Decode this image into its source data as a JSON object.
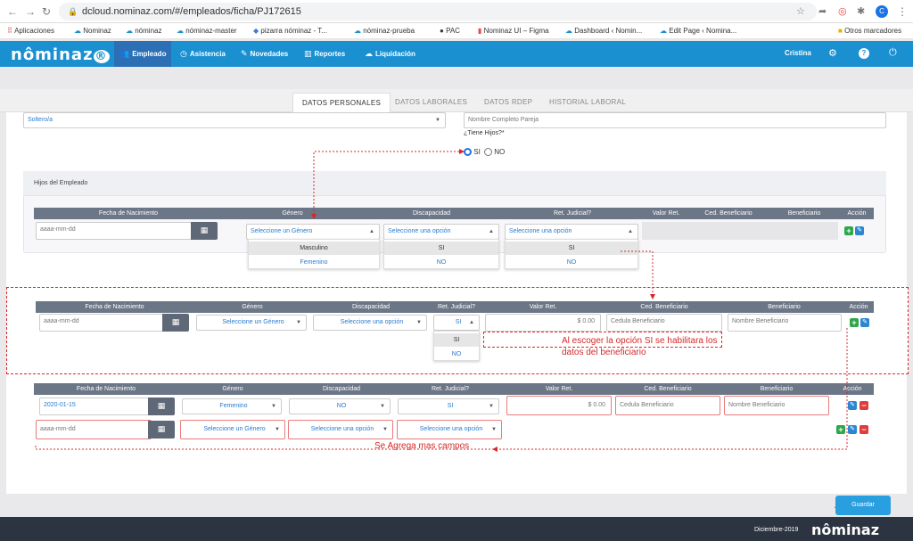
{
  "browser": {
    "url": "dcloud.nominaz.com/#/empleados/ficha/PJ172615",
    "avatar": "C",
    "bookmarks": [
      "Aplicaciones",
      "Nominaz",
      "nóminaz",
      "nóminaz-master",
      "pizarra nóminaz - T...",
      "nóminaz-prueba",
      "PAC",
      "Nominaz UI – Figma",
      "Dashboard ‹ Nomin...",
      "Edit Page ‹ Nomina...",
      "Otros marcadores"
    ]
  },
  "app": {
    "logo": "nôminaz",
    "logo_badge": "®",
    "menu": [
      "Empleado",
      "Asistencia",
      "Novedades",
      "Reportes",
      "Liquidación"
    ],
    "user": "Cristina"
  },
  "tabs": [
    "DATOS PERSONALES",
    "DATOS LABORALES",
    "DATOS RDEP",
    "HISTORIAL LABORAL"
  ],
  "top": {
    "marital": "Soltero/a",
    "partner_placeholder": "Nombre Completo Pareja",
    "question": "¿Tiene Hijos?*",
    "si": "SI",
    "no": "NO"
  },
  "section": {
    "title": "Hijos del Empleado"
  },
  "table1": {
    "headers": [
      "Fecha de Nacimiento",
      "Género",
      "Discapacidad",
      "Ret. Judicial?",
      "Valor Ret.",
      "Ced. Beneficiario",
      "Beneficiario",
      "Acción"
    ],
    "date_placeholder": "aaaa-mm-dd",
    "genero": "Seleccione un Género",
    "disc": "Seleccione una opción",
    "ret": "Seleccione una opción",
    "genero_opts": [
      "Masculino",
      "Femenino"
    ],
    "disc_opts": [
      "SI",
      "NO"
    ],
    "ret_opts": [
      "SI",
      "NO"
    ]
  },
  "table2": {
    "headers": [
      "Fecha de Nacimiento",
      "Género",
      "Discapacidad",
      "Ret. Judicial?",
      "Valor Ret.",
      "Ced. Beneficiario",
      "Beneficiario",
      "Acción"
    ],
    "date_placeholder": "aaaa-mm-dd",
    "genero": "Seleccione un Género",
    "disc": "Seleccione una opción",
    "ret": "SI",
    "valor": "$ 0.00",
    "ced": "Cedula Beneficiario",
    "benef": "Nombre Beneficiario",
    "ret_opts": [
      "SI",
      "NO"
    ]
  },
  "note1": "Al escoger la opción SI se habilitara los datos del beneficiario",
  "table3": {
    "headers": [
      "Fecha de Nacimiento",
      "Género",
      "Discapacidad",
      "Ret. Judicial?",
      "Valor Ret.",
      "Ced. Beneficiario",
      "Beneficiario",
      "Acción"
    ],
    "row1": {
      "fecha": "2020-01-15",
      "genero": "Femenino",
      "disc": "NO",
      "ret": "SI",
      "valor": "$ 0.00",
      "ced": "Cedula Beneficiario",
      "benef": "Nombre Beneficiario"
    },
    "row2": {
      "fecha": "aaaa-mm-dd",
      "genero": "Seleccione un Género",
      "disc": "Seleccione una opción",
      "ret": "Seleccione una opción"
    }
  },
  "note2": "Se Agrega mas campos",
  "save": "Guardar",
  "footer": {
    "date": "Diciembre-2019",
    "logo": "nôminaz"
  },
  "colors": {
    "accent": "#1a90d1",
    "annotation": "#d62828"
  }
}
